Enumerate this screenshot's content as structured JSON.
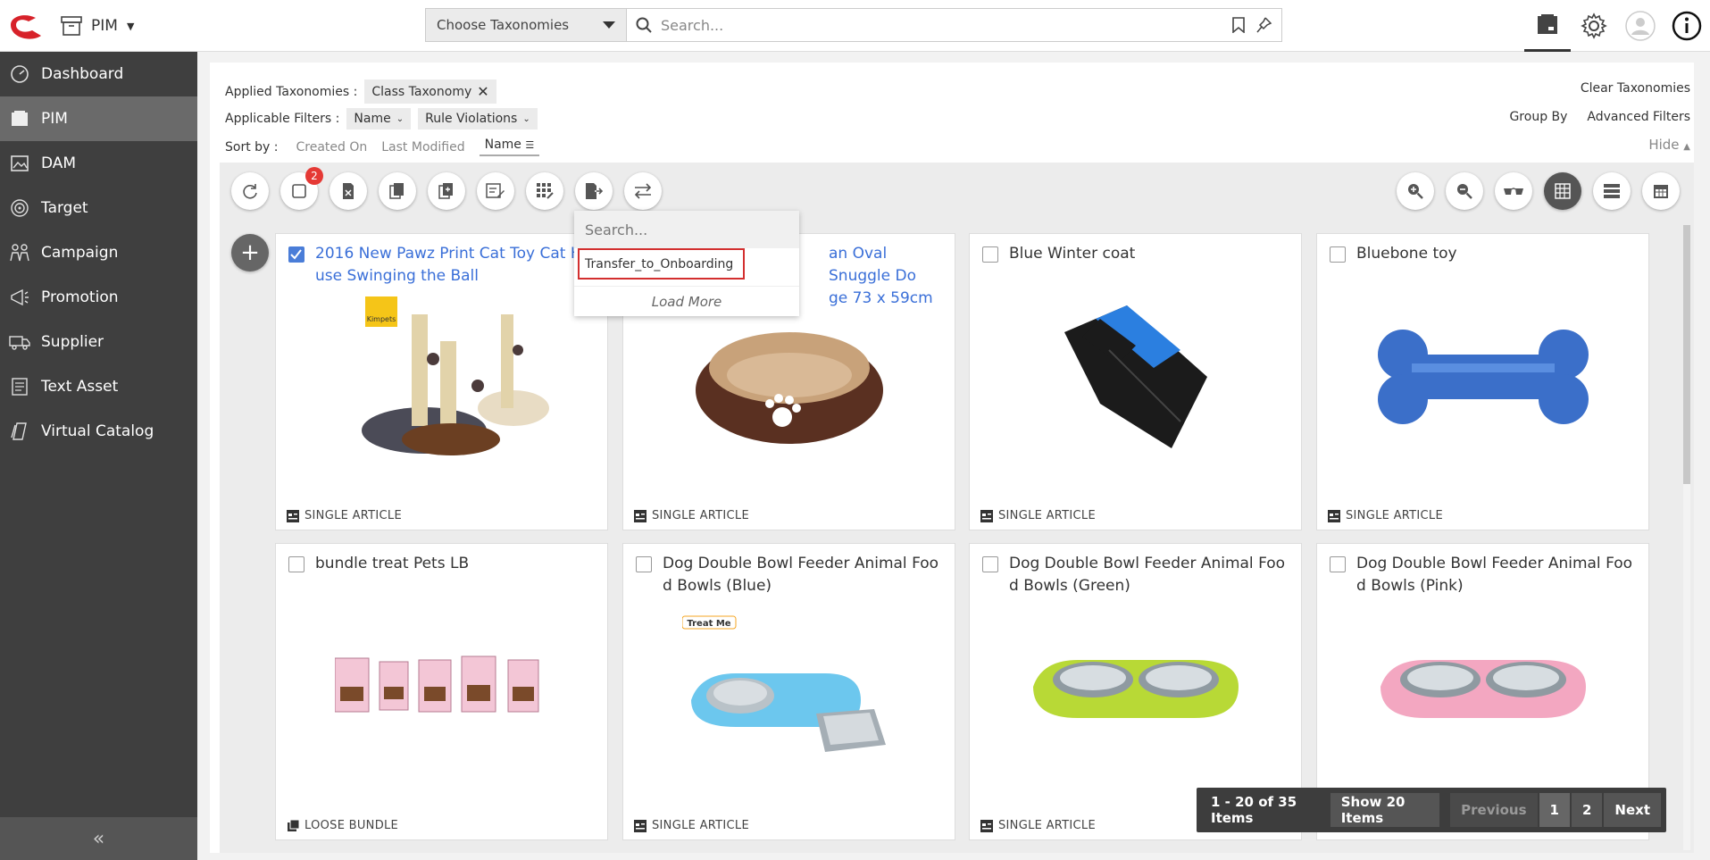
{
  "topbar": {
    "app_name": "PIM",
    "taxonomy_select": "Choose Taxonomies",
    "search_placeholder": "Search..."
  },
  "sidebar": {
    "items": [
      {
        "label": "Dashboard",
        "icon": "dashboard-icon"
      },
      {
        "label": "PIM",
        "icon": "pim-icon",
        "active": true
      },
      {
        "label": "DAM",
        "icon": "dam-icon"
      },
      {
        "label": "Target",
        "icon": "target-icon"
      },
      {
        "label": "Campaign",
        "icon": "campaign-icon"
      },
      {
        "label": "Promotion",
        "icon": "promotion-icon"
      },
      {
        "label": "Supplier",
        "icon": "supplier-icon"
      },
      {
        "label": "Text Asset",
        "icon": "text-asset-icon"
      },
      {
        "label": "Virtual Catalog",
        "icon": "virtual-catalog-icon"
      }
    ]
  },
  "filters": {
    "applied_label": "Applied Taxonomies :",
    "applied_chip": "Class Taxonomy",
    "applicable_label": "Applicable Filters :",
    "filter_name": "Name",
    "filter_rules": "Rule Violations",
    "sort_label": "Sort by :",
    "sort_created": "Created On",
    "sort_modified": "Last Modified",
    "sort_name": "Name",
    "clear": "Clear Taxonomies",
    "group_by": "Group By",
    "advanced": "Advanced Filters",
    "hide": "Hide"
  },
  "toolbar": {
    "selected_count": "2"
  },
  "dropdown": {
    "search_placeholder": "Search...",
    "item": "Transfer_to_Onboarding",
    "load_more": "Load More"
  },
  "cards": [
    {
      "title": "2016 New Pawz Print Cat Toy Cat House Swinging the Ball",
      "visible_title": "2016 New Pawz Print Cat Toy Cat H…use Swinging the Ball",
      "line1": "2016 New Pawz Print Cat Toy Cat H",
      "line2": "use Swinging the Ball",
      "type": "SINGLE ARTICLE",
      "checked": true,
      "link": true
    },
    {
      "line1": "an Oval Snuggle Do",
      "line2": "ge 73 x 59cm",
      "type": "SINGLE ARTICLE",
      "checked": false,
      "link": true
    },
    {
      "line1": "Blue Winter coat",
      "line2": "",
      "type": "SINGLE ARTICLE",
      "checked": false,
      "link": false
    },
    {
      "line1": "Bluebone toy",
      "line2": "",
      "type": "SINGLE ARTICLE",
      "checked": false,
      "link": false
    },
    {
      "line1": "bundle treat Pets LB",
      "line2": "",
      "type": "LOOSE BUNDLE",
      "checked": false,
      "link": false
    },
    {
      "line1": "Dog Double Bowl Feeder Animal Foo",
      "line2": "d Bowls (Blue)",
      "type": "SINGLE ARTICLE",
      "checked": false,
      "link": false
    },
    {
      "line1": "Dog Double Bowl Feeder Animal Foo",
      "line2": "d Bowls (Green)",
      "type": "SINGLE ARTICLE",
      "checked": false,
      "link": false
    },
    {
      "line1": "Dog Double Bowl Feeder Animal Foo",
      "line2": "d Bowls (Pink)",
      "type": "SINGLE ARTICLE",
      "checked": false,
      "link": false
    }
  ],
  "image_labels": {
    "kimpets": "Kimpets",
    "treatme": "Treat Me"
  },
  "pagination": {
    "info": "1 - 20 of 35 Items",
    "show": "Show 20 Items",
    "previous": "Previous",
    "page1": "1",
    "page2": "2",
    "next": "Next"
  }
}
